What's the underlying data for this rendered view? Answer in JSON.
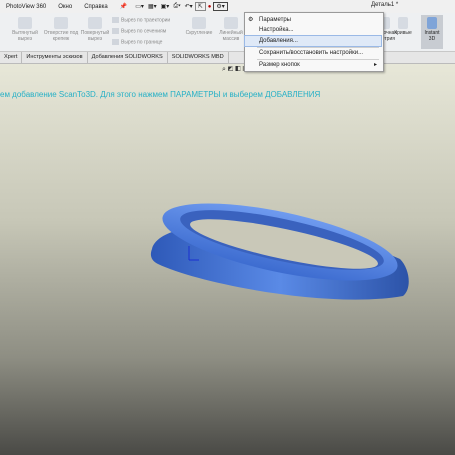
{
  "menubar": {
    "items": [
      "PhotoView 360",
      "Окно",
      "Справка"
    ],
    "document_title": "Деталь1 *"
  },
  "ribbon": {
    "buttons": [
      {
        "label": "Вытянутый вырез"
      },
      {
        "label": "Отверстие под крепеж"
      },
      {
        "label": "Повернутый вырез"
      },
      {
        "label": "Скругление"
      },
      {
        "label": "Линейный массив"
      },
      {
        "label": "Справочная геометрия"
      },
      {
        "label": "Кривые"
      },
      {
        "label": "Instant 3D"
      }
    ],
    "small_buttons": [
      "Вырез по траектории",
      "Вырез по сечениям",
      "Вырез по границе"
    ]
  },
  "tabs": [
    "Xpert",
    "Инструменты эскизов",
    "Добавления SOLIDWORKS",
    "SOLIDWORKS MBD"
  ],
  "dropdown": {
    "items": [
      "Параметры",
      "Настройка...",
      "Добавления...",
      "Сохранить/восстановить настройки...",
      "Размер кнопок"
    ]
  },
  "viewport": {
    "caption": "ем добавление ScanTo3D. Для этого нажмем ПАРАМЕТРЫ и выберем ДОБАВЛЕНИЯ"
  },
  "colors": {
    "part": "#4d7fdf",
    "caption": "#26b0c6",
    "highlight": "#dfe9f7"
  }
}
